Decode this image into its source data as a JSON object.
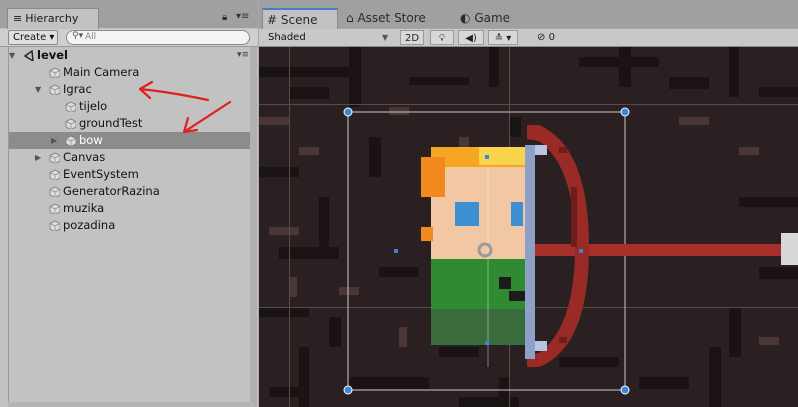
{
  "hierarchy": {
    "tab_label": "Hierarchy",
    "tab_icon": "≡",
    "create_label": "Create",
    "search_placeholder": "All",
    "items": [
      {
        "label": "level",
        "depth": 0,
        "expanded": true,
        "root": true
      },
      {
        "label": "Main Camera",
        "depth": 1
      },
      {
        "label": "Igrac",
        "depth": 1,
        "expanded": true
      },
      {
        "label": "tijelo",
        "depth": 2
      },
      {
        "label": "groundTest",
        "depth": 2
      },
      {
        "label": "bow",
        "depth": 2,
        "collapsed": true,
        "selected": true
      },
      {
        "label": "Canvas",
        "depth": 1,
        "collapsed": true
      },
      {
        "label": "EventSystem",
        "depth": 1
      },
      {
        "label": "GeneratorRazina",
        "depth": 1
      },
      {
        "label": "muzika",
        "depth": 1
      },
      {
        "label": "pozadina",
        "depth": 1
      }
    ]
  },
  "scene": {
    "tabs": [
      {
        "label": "Scene",
        "icon": "#"
      },
      {
        "label": "Asset Store",
        "icon": "⌂"
      },
      {
        "label": "Game",
        "icon": "◐"
      }
    ],
    "shading_mode": "Shaded",
    "btn_2d": "2D",
    "hidden_count": "0"
  },
  "colors": {
    "accent_tab": "#4a7ac8",
    "selection": "#8c8c8c",
    "annotation_red": "#e0201c",
    "gizmo_blue": "#3a86d8"
  }
}
